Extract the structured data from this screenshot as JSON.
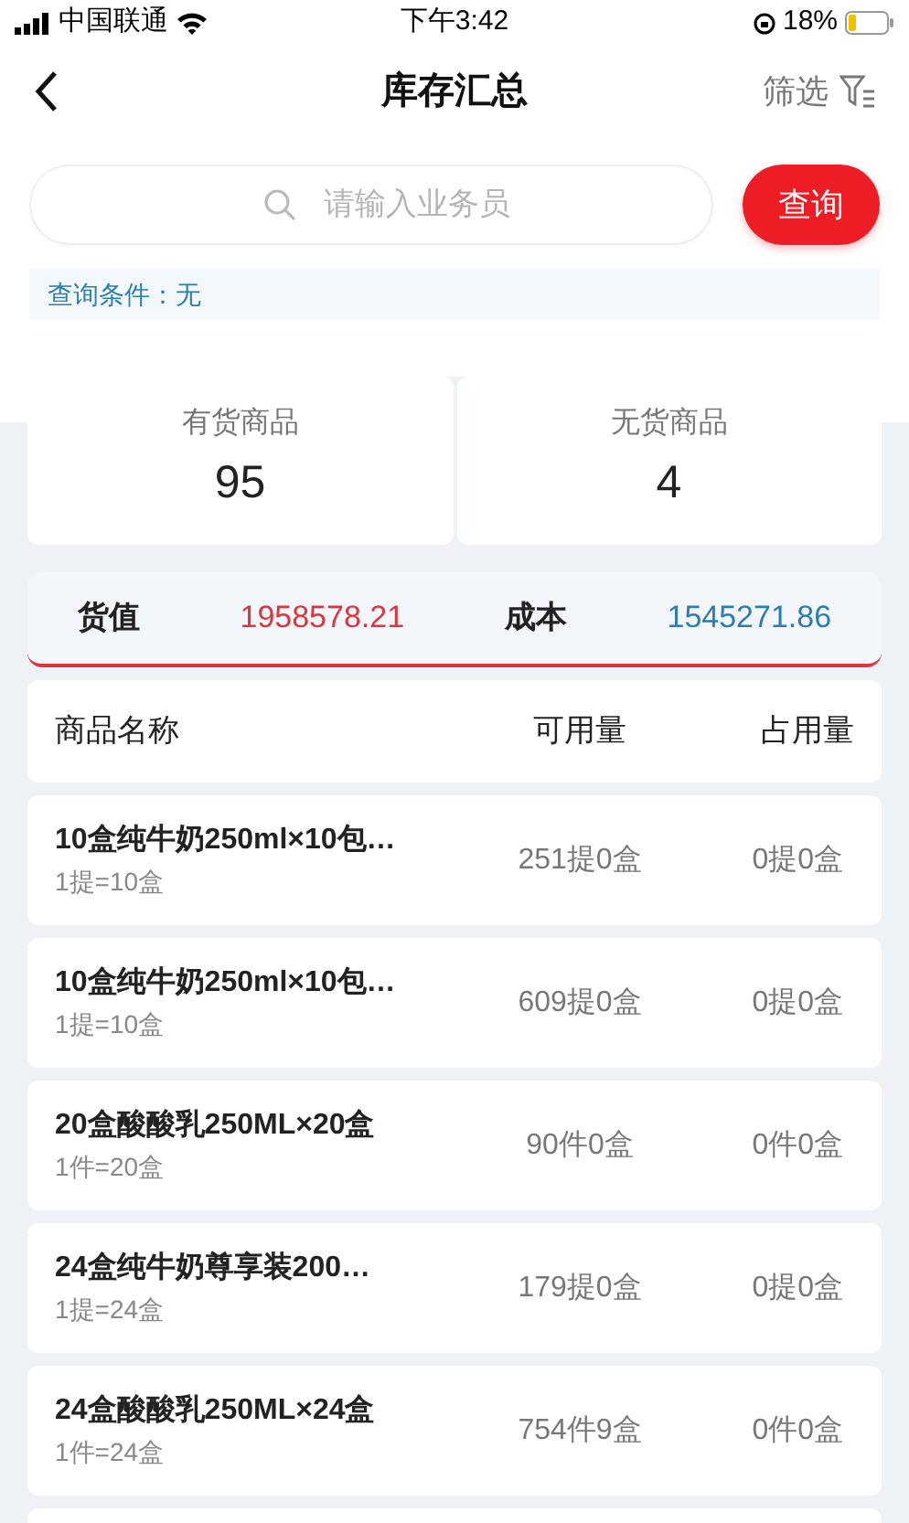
{
  "status_bar": {
    "carrier": "中国联通",
    "time": "下午3:42",
    "battery": "18%"
  },
  "nav": {
    "title": "库存汇总",
    "filter": "筛选"
  },
  "search": {
    "placeholder": "请输入业务员",
    "button": "查询"
  },
  "condition": "查询条件：无",
  "summary": [
    {
      "label": "有货商品",
      "value": "95"
    },
    {
      "label": "无货商品",
      "value": "4"
    }
  ],
  "totals": [
    {
      "label": "货值",
      "value": "1958578.21",
      "color": "#d9363e"
    },
    {
      "label": "成本",
      "value": "1545271.86",
      "color": "#2b7fb0"
    }
  ],
  "table": {
    "columns": [
      "商品名称",
      "可用量",
      "占用量"
    ],
    "rows": [
      {
        "name": "10盒纯牛奶250ml×10包…",
        "unit": "1提=10盒",
        "available": "251提0盒",
        "occupied": "0提0盒"
      },
      {
        "name": "10盒纯牛奶250ml×10包…",
        "unit": "1提=10盒",
        "available": "609提0盒",
        "occupied": "0提0盒"
      },
      {
        "name": "20盒酸酸乳250ML×20盒",
        "unit": "1件=20盒",
        "available": "90件0盒",
        "occupied": "0件0盒"
      },
      {
        "name": "24盒纯牛奶尊享装200…",
        "unit": "1提=24盒",
        "available": "179提0盒",
        "occupied": "0提0盒"
      },
      {
        "name": "24盒酸酸乳250ML×24盒",
        "unit": "1件=24盒",
        "available": "754件9盒",
        "occupied": "0件0盒"
      }
    ]
  }
}
